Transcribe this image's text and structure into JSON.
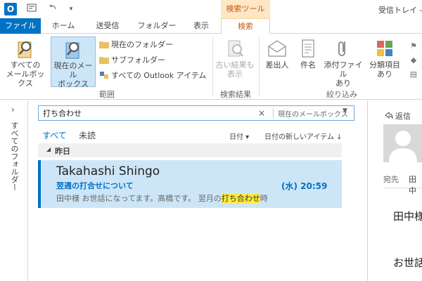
{
  "titlebar": {
    "app_icon": "O",
    "context_tab_header": "検索ツール",
    "window_title": "受信トレイ -"
  },
  "tabs": {
    "file": "ファイル",
    "home": "ホーム",
    "send_receive": "送受信",
    "folder": "フォルダー",
    "view": "表示",
    "search": "検索"
  },
  "ribbon": {
    "all_mailboxes": "すべての\nメールボックス",
    "current_mailbox": "現在のメール\nボックス",
    "current_folder": "現在のフォルダー",
    "subfolders": "サブフォルダー",
    "all_outlook_items": "すべての Outlook アイテム",
    "scope_group": "範囲",
    "older_results": "古い結果も\n表示",
    "results_group": "検索結果",
    "from": "差出人",
    "subject": "件名",
    "has_attachments": "添付ファイル\nあり",
    "categorized": "分類項目\nあり",
    "refine_group": "絞り込み"
  },
  "folder_pane": {
    "chevron": "›",
    "label": "すべてのフォルダー"
  },
  "search": {
    "value": "打ち合わせ",
    "clear": "×",
    "scope": "現在のメールボックス",
    "scope_chevron": "▼"
  },
  "filters": {
    "all": "すべて",
    "unread": "未読",
    "sort_by": "日付 ▾",
    "order": "日付の新しいアイテム ↓"
  },
  "list": {
    "group_header": "昨日",
    "group_tri": "◢",
    "item": {
      "sender": "Takahashi Shingo",
      "subject": "翌週の打合せについて",
      "time": "(水) 20:59",
      "preview_pre": "田中様  お世話になってます。高橋です。  翌月の",
      "preview_hl": "打ち合わせ",
      "preview_post": "時"
    }
  },
  "reading": {
    "reply": "返信",
    "to_label": "宛先",
    "to_value": "田中",
    "body_line1": "田中様",
    "body_line2": "お世話"
  }
}
